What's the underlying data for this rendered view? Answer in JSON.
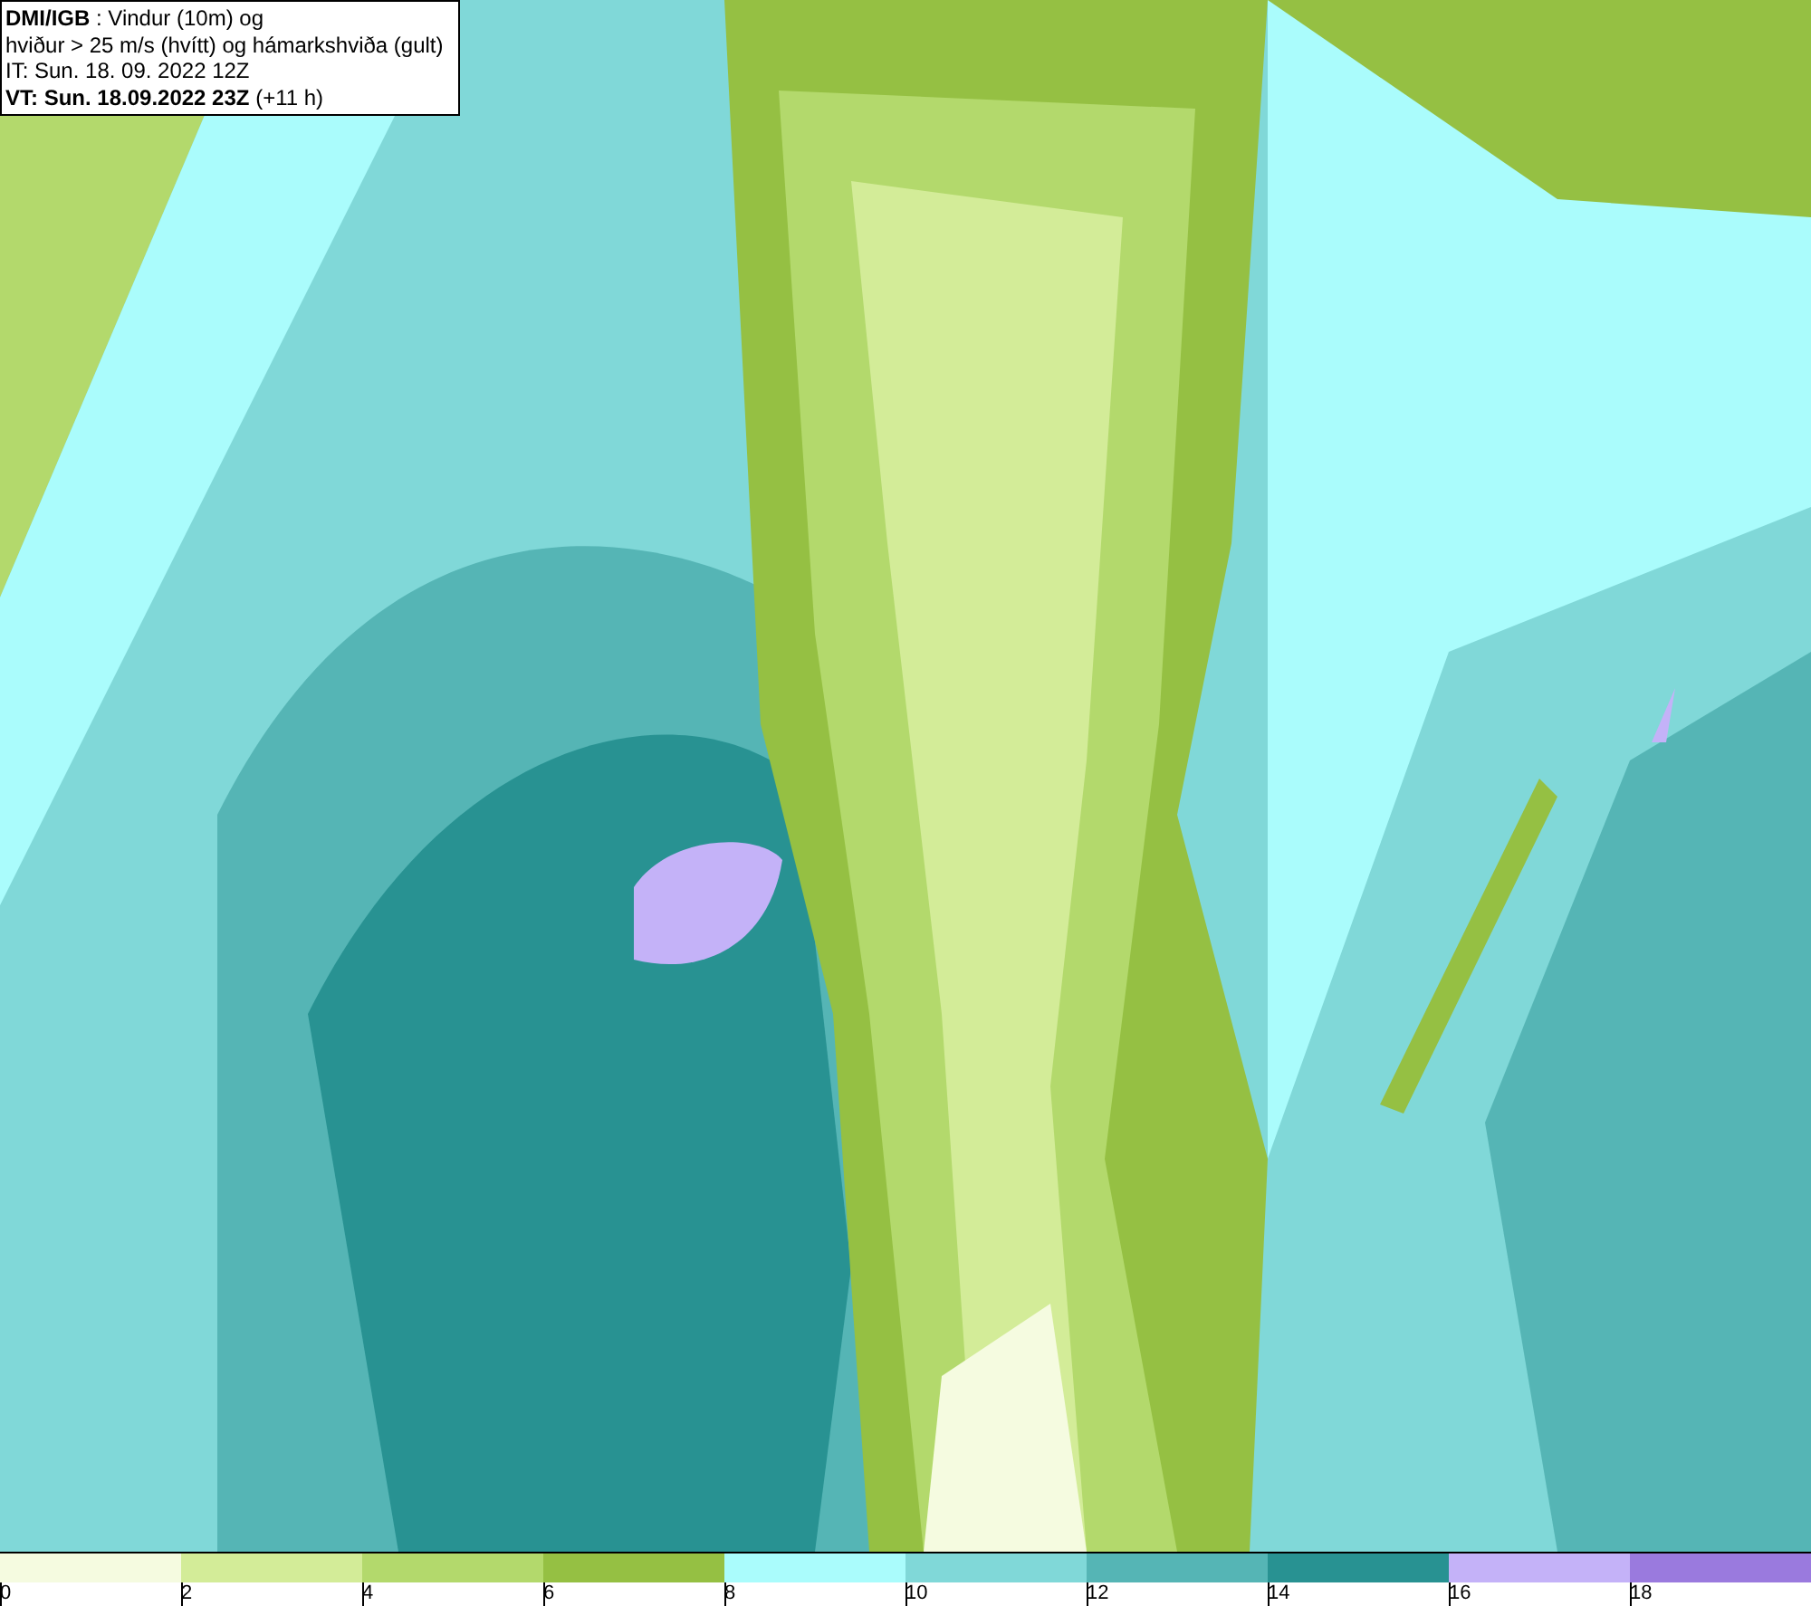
{
  "caption": {
    "lines": [
      "**DMI/IGB** : Vindur (10m) og",
      "hviður > 25 m/s (hvítt) og hámarkshviða (gult)",
      "IT: Sun. 18. 09. 2022 12Z",
      "**VT: Sun. 18.09.2022 23Z** (+11 h)"
    ]
  },
  "legend": {
    "bins": [
      {
        "color": "#f5fbe0",
        "label": "0"
      },
      {
        "color": "#d3ec98",
        "label": "2"
      },
      {
        "color": "#b3d96c",
        "label": "4"
      },
      {
        "color": "#95c043",
        "label": "6"
      },
      {
        "color": "#aafcfc",
        "label": "8"
      },
      {
        "color": "#80d8d8",
        "label": "10"
      },
      {
        "color": "#55b5b5",
        "label": "12"
      },
      {
        "color": "#289292",
        "label": "14"
      },
      {
        "color": "#c4b2f8",
        "label": "16"
      },
      {
        "color": "#9a7ade",
        "label": "18"
      }
    ]
  }
}
